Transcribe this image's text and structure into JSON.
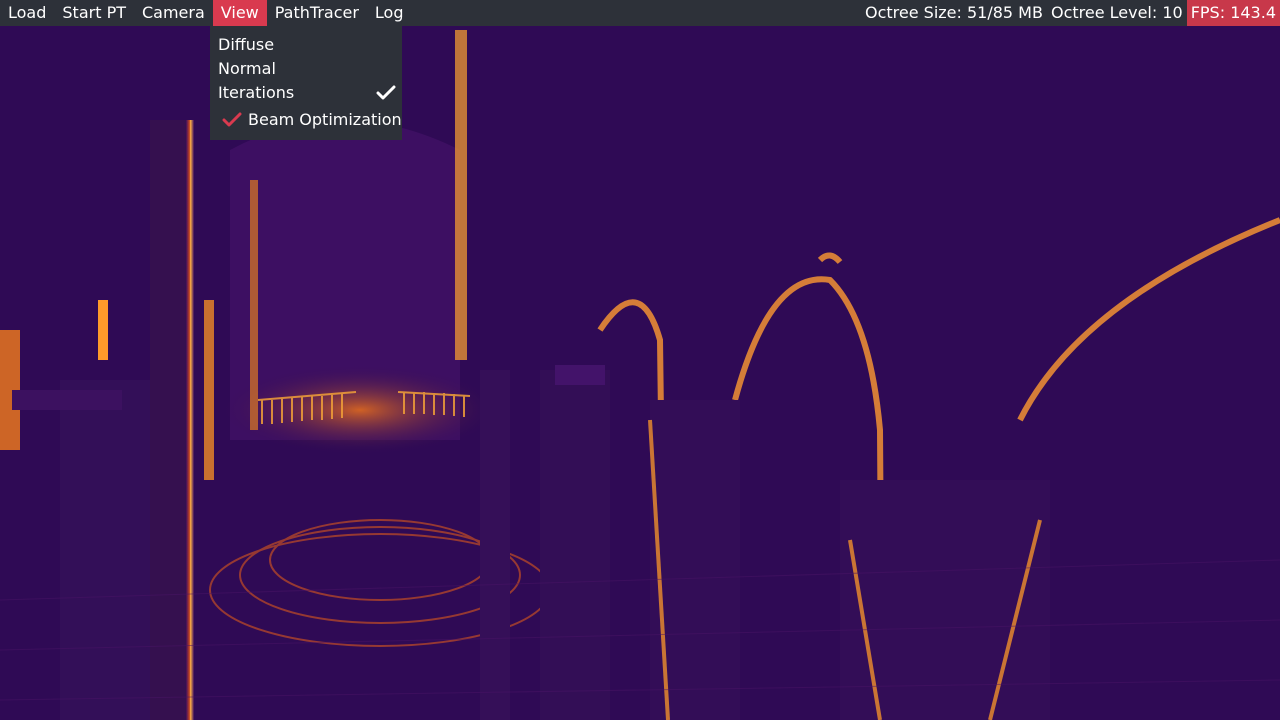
{
  "menubar": {
    "items": [
      {
        "label": "Load"
      },
      {
        "label": "Start PT"
      },
      {
        "label": "Camera"
      },
      {
        "label": "View",
        "active": true
      },
      {
        "label": "PathTracer"
      },
      {
        "label": "Log"
      }
    ],
    "stats": {
      "octree_size": "Octree Size: 51/85 MB",
      "octree_level": "Octree Level: 10",
      "fps": "FPS: 143.4"
    }
  },
  "view_menu": {
    "diffuse": "Diffuse",
    "normal": "Normal",
    "iterations": "Iterations",
    "iterations_checked": true,
    "beam_optimization": "Beam Optimization",
    "beam_optimization_checked": true
  },
  "colors": {
    "menubar_bg": "#2d3139",
    "accent": "#d93a4f",
    "render_bg": "#2f0a55",
    "render_hot": "#ff9a1e"
  },
  "icons": {
    "iterations_check": "check-icon",
    "beam_check": "check-icon"
  }
}
